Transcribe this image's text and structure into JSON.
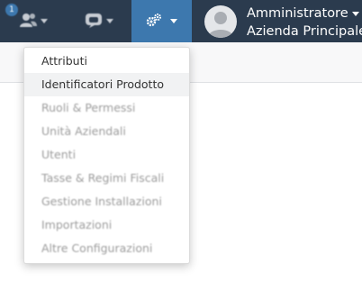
{
  "topbar": {
    "users_badge": "1",
    "profile": {
      "name": "Amministratore",
      "company": "Azienda Principale"
    },
    "colors": {
      "bar": "#2b3b4e",
      "active": "#3d78ae"
    },
    "icons": {
      "users": "users-icon",
      "support": "support-icon",
      "settings": "gears-icon",
      "avatar": "user-avatar-icon"
    }
  },
  "settings_menu": {
    "items": [
      {
        "label": "Attributi"
      },
      {
        "label": "Identificatori Prodotto"
      },
      {
        "label": "Ruoli & Permessi"
      },
      {
        "label": "Unità Aziendali"
      },
      {
        "label": "Utenti"
      },
      {
        "label": "Tasse & Regimi Fiscali"
      },
      {
        "label": "Gestione Installazioni"
      },
      {
        "label": "Importazioni"
      },
      {
        "label": "Altre Configurazioni"
      }
    ]
  }
}
